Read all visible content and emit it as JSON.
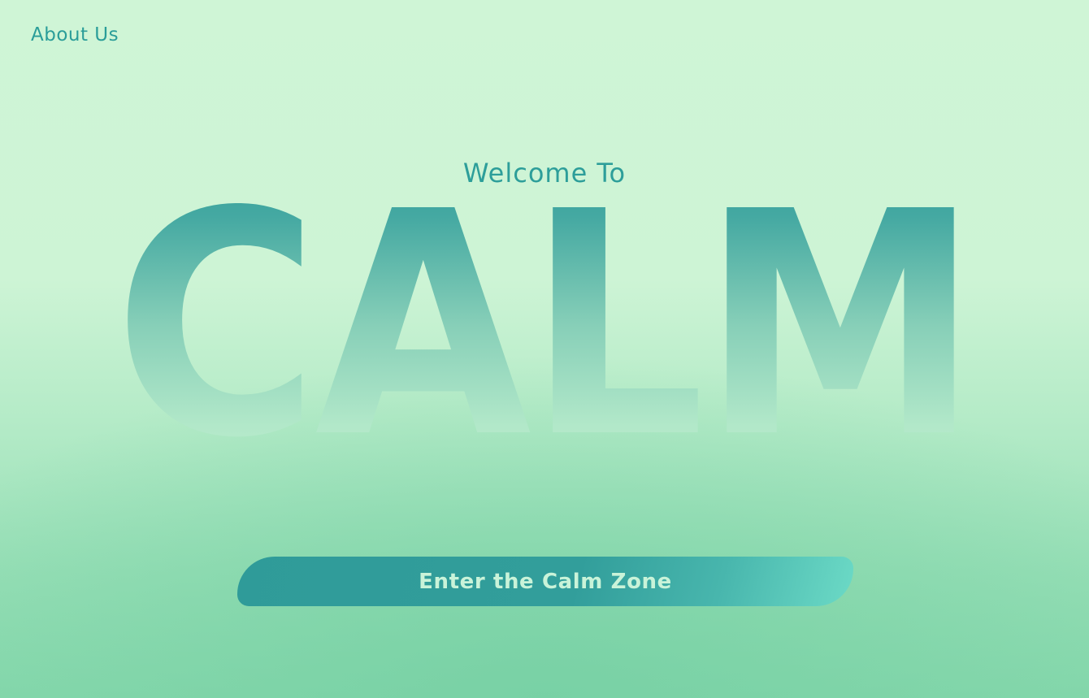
{
  "nav": {
    "about_label": "About Us"
  },
  "hero": {
    "welcome_text": "Welcome To",
    "title_text": "CALM",
    "cta_label": "Enter the Calm Zone"
  },
  "colors": {
    "accent_teal": "#2f9b99",
    "background_top": "#cff5d6",
    "background_bottom": "#86d8ac",
    "button_text": "#c9f3d9"
  }
}
